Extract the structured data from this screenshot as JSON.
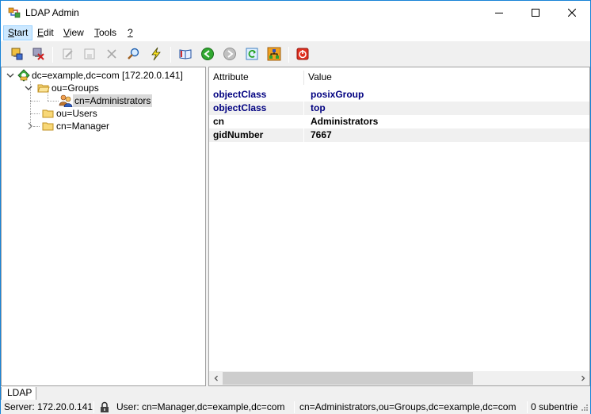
{
  "window": {
    "title": "LDAP Admin",
    "controls": [
      "minimize",
      "maximize",
      "close"
    ]
  },
  "menu": {
    "items": [
      {
        "label": "Start",
        "accel": "S",
        "rest": "tart"
      },
      {
        "label": "Edit",
        "accel": "E",
        "rest": "dit"
      },
      {
        "label": "View",
        "accel": "V",
        "rest": "iew"
      },
      {
        "label": "Tools",
        "accel": "T",
        "rest": "ools"
      },
      {
        "label": "?",
        "accel": "?",
        "rest": ""
      }
    ]
  },
  "toolbar": {
    "buttons": [
      "connect-icon",
      "disconnect-icon",
      "edit-entry-icon",
      "save-icon",
      "delete-icon",
      "search-icon",
      "quick-action-icon",
      "schema-book-icon",
      "back-icon",
      "forward-icon",
      "refresh-icon",
      "tree-structure-icon",
      "exit-icon"
    ]
  },
  "tree": {
    "root": "dc=example,dc=com [172.20.0.141]",
    "groups": "ou=Groups",
    "administrators": "cn=Administrators",
    "users": "ou=Users",
    "manager": "cn=Manager"
  },
  "attributes": {
    "headers": {
      "attribute": "Attribute",
      "value": "Value"
    },
    "rows": [
      {
        "attribute": "objectClass",
        "value": "posixGroup"
      },
      {
        "attribute": "objectClass",
        "value": "top"
      },
      {
        "attribute": "cn",
        "value": "Administrators"
      },
      {
        "attribute": "gidNumber",
        "value": "7667"
      }
    ]
  },
  "tabs": {
    "active": "LDAP"
  },
  "status": {
    "server": "Server: 172.20.0.141",
    "user": "User: cn=Manager,dc=example,dc=com",
    "dn": "cn=Administrators,ou=Groups,dc=example,dc=com",
    "subentries": "0 subentrie"
  },
  "colors": {
    "accent_border": "#1883d7",
    "menu_highlight": "#cce8ff",
    "attribute_blue": "#000080"
  }
}
